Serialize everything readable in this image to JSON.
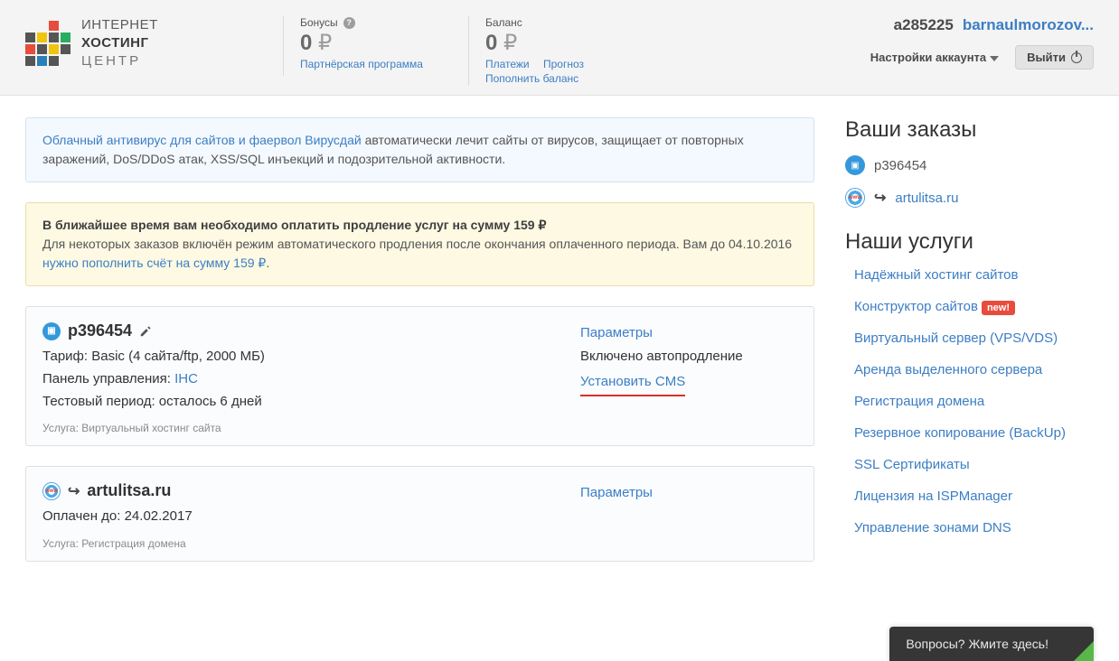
{
  "logo": {
    "line1": "ИНТЕРНЕТ",
    "line2": "ХОСТИНГ",
    "line3": "ЦЕНТР"
  },
  "stats": {
    "bonus": {
      "label": "Бонусы",
      "value": "0",
      "currency": "₽",
      "link": "Партнёрская программа"
    },
    "balance": {
      "label": "Баланс",
      "value": "0",
      "currency": "₽",
      "links": {
        "payments": "Платежи",
        "forecast": "Прогноз",
        "topup": "Пополнить баланс"
      }
    }
  },
  "user": {
    "id": "a285225",
    "name": "barnaulmorozov...",
    "settings": "Настройки аккаунта",
    "logout": "Выйти"
  },
  "infobox": {
    "link": "Облачный антивирус для сайтов и фаервол Вирусдай",
    "text": " автоматически лечит сайты от вирусов, защищает от повторных заражений, DoS/DDoS атак, XSS/SQL инъекций и подозрительной активности."
  },
  "warnbox": {
    "strong": "В ближайшее время вам необходимо оплатить продление услуг на сумму 159 ₽",
    "text1": "Для некоторых заказов включён режим автоматического продления после окончания оплаченного периода. Вам до 04.10.2016 ",
    "link": "нужно пополнить счёт на сумму 159 ₽",
    "text2": "."
  },
  "orders": [
    {
      "title": "p396454",
      "lines": {
        "tariff_label": "Тариф: ",
        "tariff": "Basic (4 сайта/ftp, 2000 МБ)",
        "panel_label": "Панель управления: ",
        "panel_link": "IHC",
        "test_label": "Тестовый период: ",
        "test": "осталось 6 дней"
      },
      "svc_label": "Услуга: ",
      "svc": "Виртуальный хостинг сайта",
      "params": "Параметры",
      "autorenew": "Включено автопродление",
      "cms": "Установить CMS"
    },
    {
      "title": "artulitsa.ru",
      "paid_label": "Оплачен до: ",
      "paid": "24.02.2017",
      "svc_label": "Услуга: ",
      "svc": "Регистрация домена",
      "params": "Параметры"
    }
  ],
  "sidebar": {
    "orders_title": "Ваши заказы",
    "order_items": [
      "p396454",
      "artulitsa.ru"
    ],
    "services_title": "Наши услуги",
    "services": [
      {
        "label": "Надёжный хостинг сайтов",
        "new": false
      },
      {
        "label": "Конструктор сайтов",
        "new": true
      },
      {
        "label": "Виртуальный сервер (VPS/VDS)",
        "new": false
      },
      {
        "label": "Аренда выделенного сервера",
        "new": false
      },
      {
        "label": "Регистрация домена",
        "new": false
      },
      {
        "label": "Резервное копирование (BackUp)",
        "new": false
      },
      {
        "label": "SSL Сертификаты",
        "new": false
      },
      {
        "label": "Лицензия на ISPManager",
        "new": false
      },
      {
        "label": "Управление зонами DNS",
        "new": false
      }
    ],
    "new_badge": "new!"
  },
  "chat": "Вопросы? Жмите здесь!"
}
